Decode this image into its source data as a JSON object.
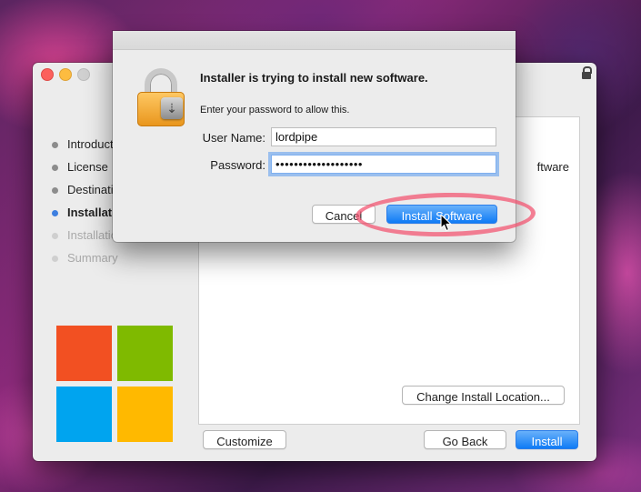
{
  "installer": {
    "steps": [
      {
        "label": "Introduction",
        "state": "done"
      },
      {
        "label": "License",
        "state": "done"
      },
      {
        "label": "Destination",
        "state": "done"
      },
      {
        "label": "Installation",
        "state": "current"
      },
      {
        "label": "Installation",
        "state": "future"
      },
      {
        "label": "Summary",
        "state": "future"
      }
    ],
    "content_partial_text": "ftware",
    "change_location_label": "Change Install Location...",
    "customize_label": "Customize",
    "go_back_label": "Go Back",
    "install_label": "Install"
  },
  "auth_dialog": {
    "title": "Installer is trying to install new software.",
    "message": "Enter your password to allow this.",
    "username_label": "User Name:",
    "username_value": "lordpipe",
    "password_label": "Password:",
    "password_value": "lordpipe12345678901",
    "cancel_label": "Cancel",
    "install_software_label": "Install Software"
  },
  "icons": {
    "lock": "padlock-icon",
    "drive": "drive-download-icon",
    "logo": "microsoft-logo"
  },
  "colors": {
    "accent": "#0f7bf5",
    "highlight_ring": "#f2506e",
    "logo_red": "#f25022",
    "logo_green": "#7fba00",
    "logo_blue": "#00a4ef",
    "logo_yellow": "#ffb900"
  }
}
